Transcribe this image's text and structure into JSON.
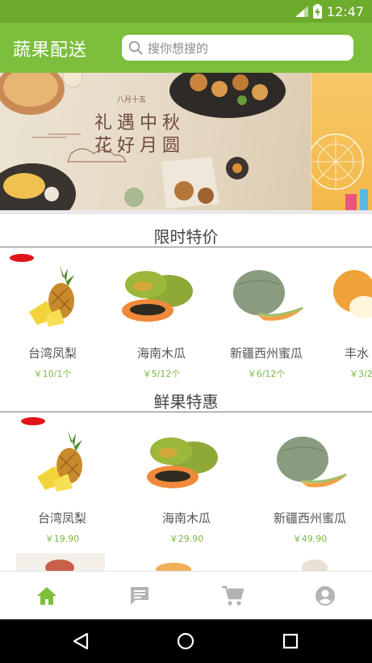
{
  "status_bar": {
    "time": "12:47",
    "icons": [
      "signal-icon",
      "battery-charging-icon"
    ]
  },
  "app_bar": {
    "title": "蔬果配送",
    "search_placeholder": "搜你想搜的"
  },
  "banner": {
    "tagline": "八月十五",
    "line1": "礼遇中秋",
    "line2": "花好月圆"
  },
  "sections": {
    "flash_sale": {
      "title": "限时特价",
      "items": [
        {
          "name": "台湾凤梨",
          "price": "￥10/1个",
          "image": "pineapple"
        },
        {
          "name": "海南木瓜",
          "price": "￥5/12个",
          "image": "papaya"
        },
        {
          "name": "新疆西州蜜瓜",
          "price": "￥6/12个",
          "image": "melon"
        },
        {
          "name": "丰水",
          "price": "￥3/2",
          "image": "pear"
        }
      ]
    },
    "fresh_deals": {
      "title": "鲜果特惠",
      "items": [
        {
          "name": "台湾凤梨",
          "price": "￥19.90",
          "image": "pineapple"
        },
        {
          "name": "海南木瓜",
          "price": "￥29.90",
          "image": "papaya"
        },
        {
          "name": "新疆西州蜜瓜",
          "price": "￥49.90",
          "image": "melon"
        }
      ]
    }
  },
  "bottom_nav": {
    "active": "home",
    "items": [
      "home-icon",
      "message-icon",
      "cart-icon",
      "account-icon"
    ]
  },
  "colors": {
    "brand_green": "#7dbe3c",
    "status_green": "#6cab2c",
    "price_green": "#7cb842",
    "inactive_icon": "#b4b4b4"
  }
}
